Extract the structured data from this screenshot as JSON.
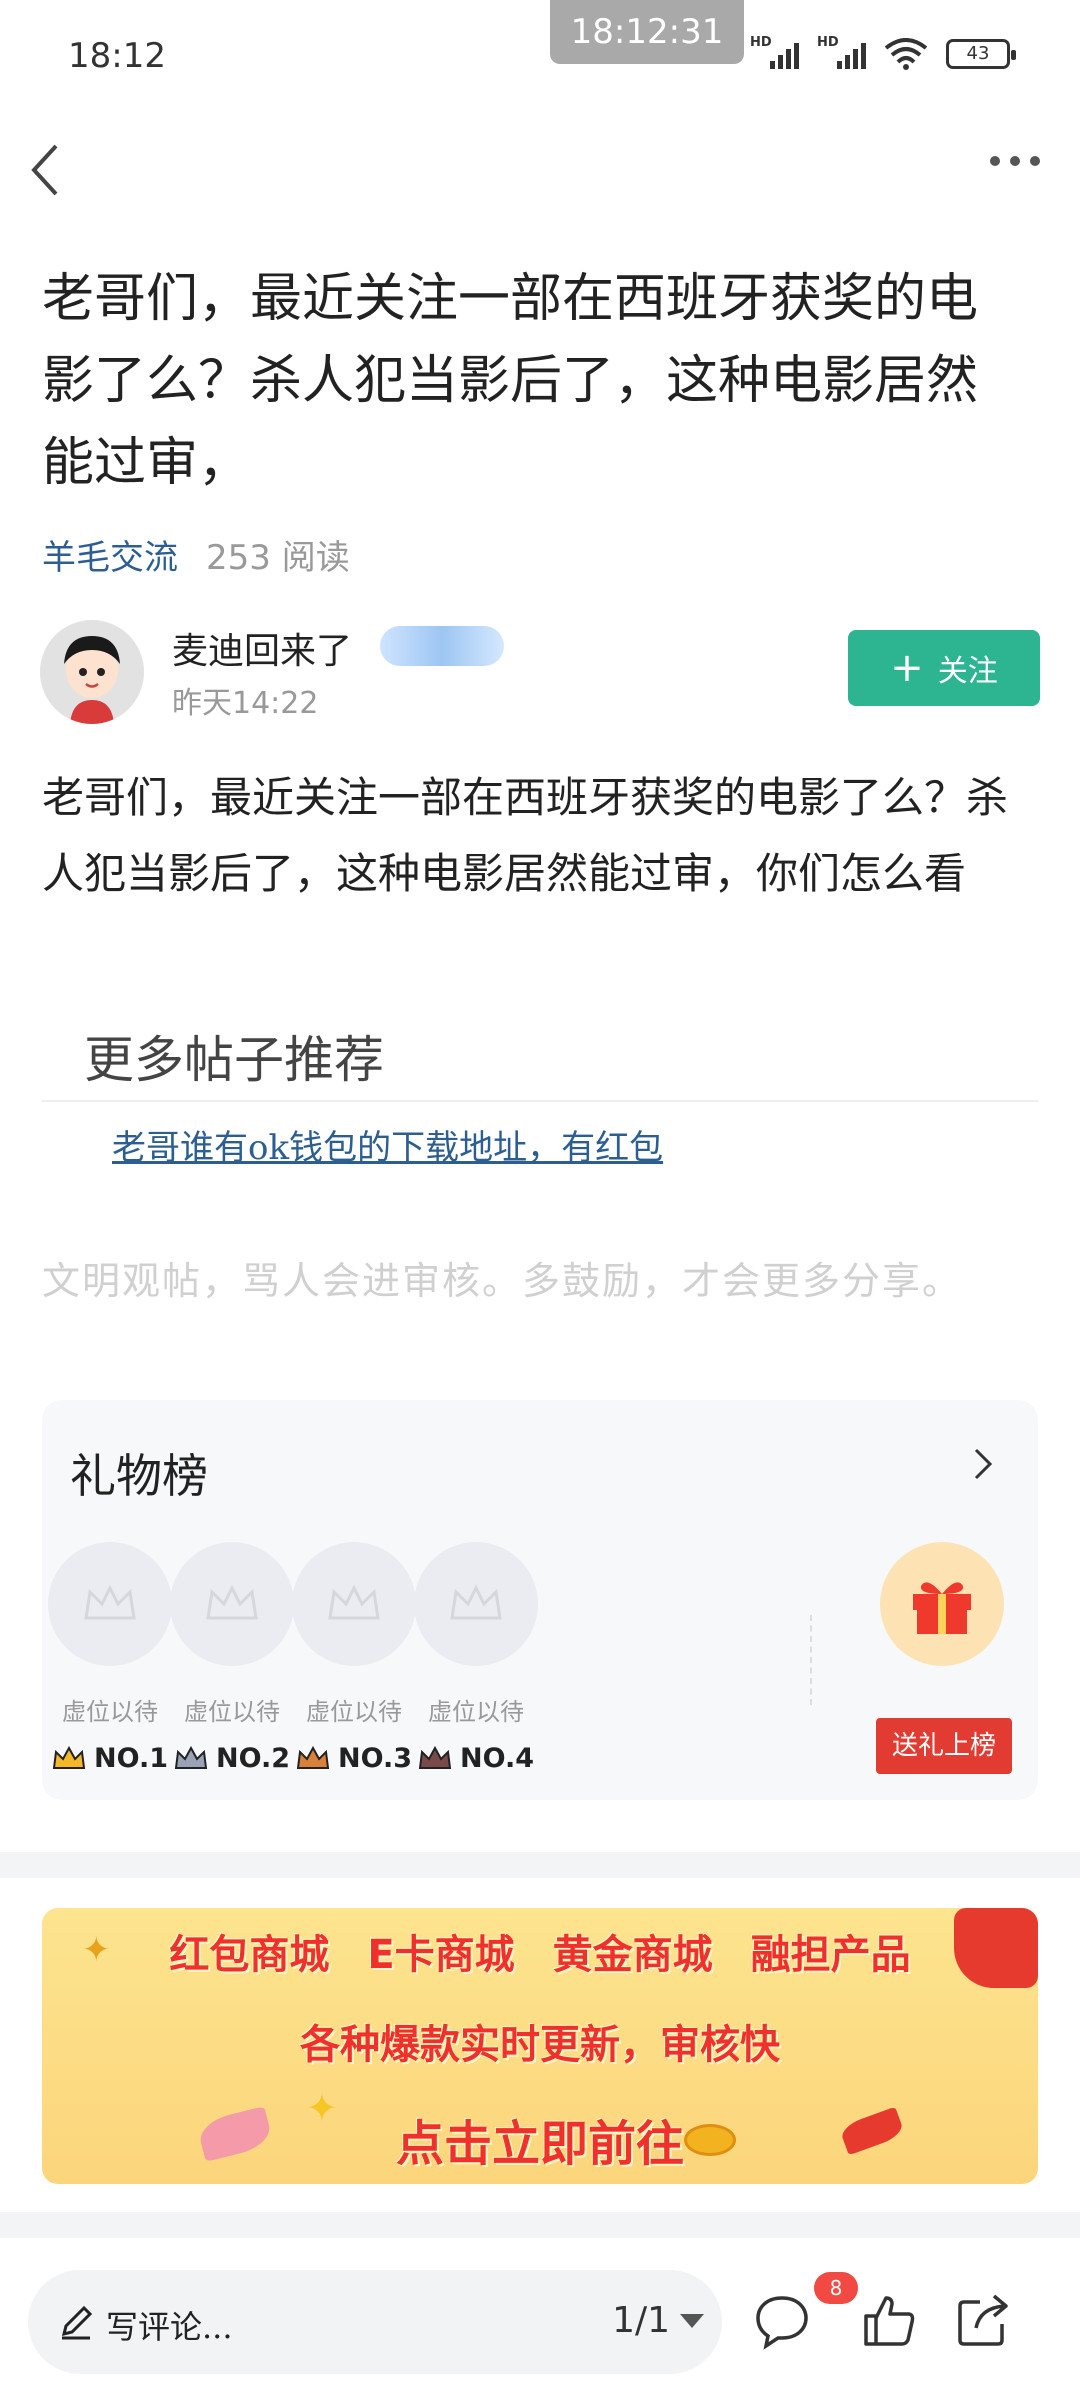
{
  "status_bar": {
    "time": "18:12",
    "clock_overlay": "18:12:31",
    "battery": "43",
    "network_label": "HD"
  },
  "post": {
    "title": "老哥们，最近关注一部在西班牙获奖的电影了么？杀人犯当影后了，这种电影居然能过审，",
    "category": "羊毛交流",
    "reads": "253 阅读",
    "author_name": "麦迪回来了",
    "author_time": "昨天14:22",
    "follow_label": "关注",
    "body": "老哥们，最近关注一部在西班牙获奖的电影了么？杀人犯当影后了，这种电影居然能过审，你们怎么看"
  },
  "recommend": {
    "heading": "更多帖子推荐",
    "link": "老哥谁有ok钱包的下载地址，有红包",
    "civility_notice": "文明观帖，骂人会进审核。多鼓励，才会更多分享。"
  },
  "gift_board": {
    "title": "礼物榜",
    "slots": [
      {
        "placeholder": "虚位以待",
        "rank": "NO.1",
        "crown_color": "#f5b82b"
      },
      {
        "placeholder": "虚位以待",
        "rank": "NO.2",
        "crown_color": "#9aa3b5"
      },
      {
        "placeholder": "虚位以待",
        "rank": "NO.3",
        "crown_color": "#d9813a"
      },
      {
        "placeholder": "虚位以待",
        "rank": "NO.4",
        "crown_color": "#7a4a4a"
      }
    ],
    "send_gift_label": "送礼上榜"
  },
  "banner": {
    "row1": [
      "红包商城",
      "E卡商城",
      "黄金商城",
      "融担产品"
    ],
    "row2": "各种爆款实时更新，审核快",
    "row3": "点击立即前往"
  },
  "bottom_bar": {
    "comment_placeholder": "写评论...",
    "pager": "1/1",
    "comment_count": "8"
  },
  "colors": {
    "accent_green": "#2db592",
    "link_blue": "#2c5e92",
    "badge_red": "#f24a42"
  }
}
